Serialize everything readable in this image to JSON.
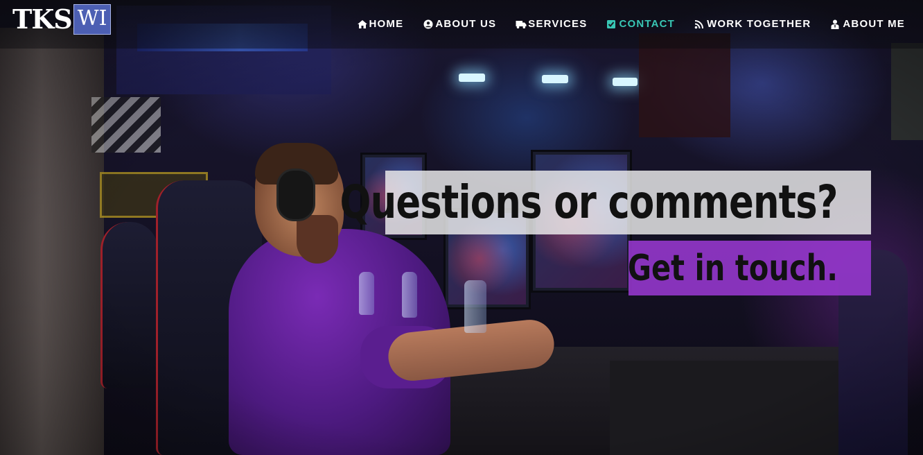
{
  "logo": {
    "part_a": "TKS",
    "part_b": "WI"
  },
  "nav": {
    "items": [
      {
        "label": "HOME",
        "icon": "home-icon"
      },
      {
        "label": "ABOUT US",
        "icon": "user-circle-icon"
      },
      {
        "label": "SERVICES",
        "icon": "truck-icon"
      },
      {
        "label": "CONTACT",
        "icon": "check-square-icon",
        "active": true
      },
      {
        "label": "WORK TOGETHER",
        "icon": "rss-icon"
      },
      {
        "label": "ABOUT ME",
        "icon": "user-tie-icon"
      }
    ]
  },
  "hero": {
    "headline": "Questions or comments?",
    "subline": "Get in touch."
  },
  "colors": {
    "nav_active": "#38c6b4",
    "logo_box": "#4c5fb3",
    "headline_box": "#eeeeee",
    "subline_box": "#9c3ad6"
  }
}
